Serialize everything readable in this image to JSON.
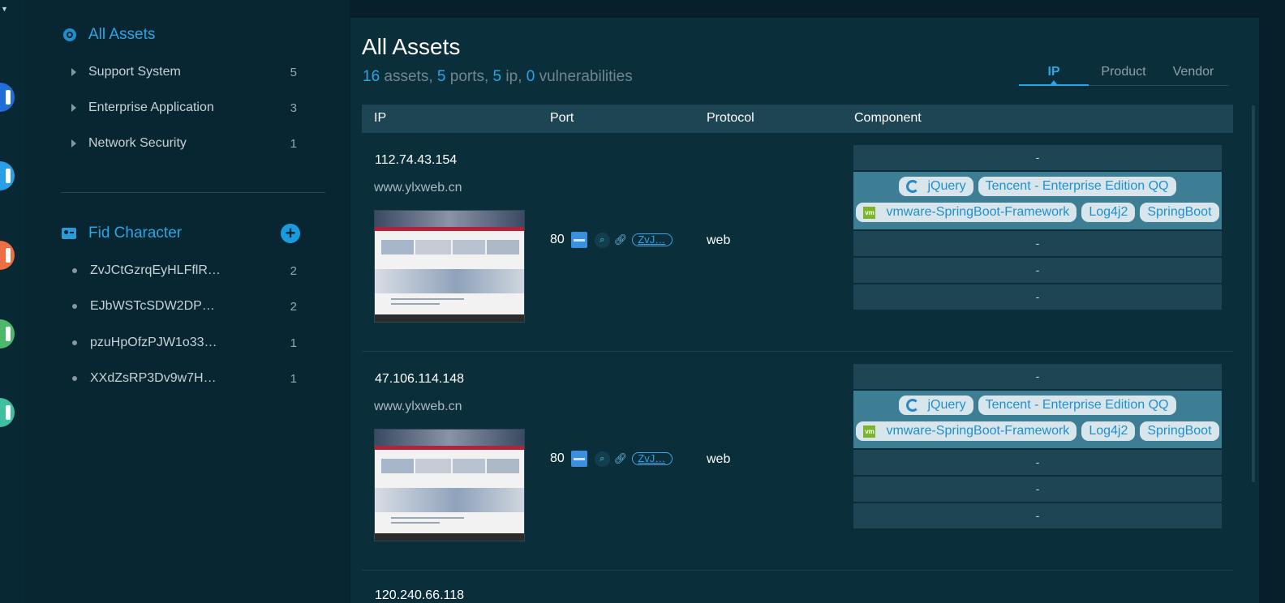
{
  "rail": {
    "icons": [
      {
        "name": "rail-app-icon-1",
        "color": "#1e6fd9"
      },
      {
        "name": "rail-app-icon-2",
        "color": "#2a9fe8"
      },
      {
        "name": "rail-app-icon-3",
        "color": "#ee6f43"
      },
      {
        "name": "rail-app-icon-4",
        "color": "#4cb86a"
      },
      {
        "name": "rail-app-icon-5",
        "color": "#3dbfa0"
      }
    ]
  },
  "sidebar": {
    "all_assets_label": "All Assets",
    "categories": [
      {
        "label": "Support System",
        "count": "5"
      },
      {
        "label": "Enterprise Application",
        "count": "3"
      },
      {
        "label": "Network Security",
        "count": "1"
      }
    ],
    "fid_section_label": "Fid Character",
    "fid_items": [
      {
        "label": "ZvJCtGzrqEyHLFflR…",
        "count": "2"
      },
      {
        "label": "EJbWSTcSDW2DP…",
        "count": "2"
      },
      {
        "label": "pzuHpOfzPJW1o33…",
        "count": "1"
      },
      {
        "label": "XXdZsRP3Dv9w7H…",
        "count": "1"
      }
    ]
  },
  "main": {
    "title": "All Assets",
    "summary": {
      "assets_num": "16",
      "assets_label": " assets, ",
      "ports_num": "5",
      "ports_label": " ports, ",
      "ip_num": "5",
      "ip_label": " ip, ",
      "vuln_num": "0",
      "vuln_label": " vulnerabilities"
    },
    "tabs": [
      "IP",
      "Product",
      "Vendor"
    ],
    "active_tab": "IP",
    "columns": {
      "ip": "IP",
      "port": "Port",
      "protocol": "Protocol",
      "component": "Component"
    },
    "rows": [
      {
        "ip": "112.74.43.154",
        "host": "www.ylxweb.cn",
        "port": "80",
        "fid_tag": "ZvJ…",
        "protocol": "web",
        "empty_cell": "-",
        "components": [
          "jQuery",
          "Tencent - Enterprise Edition QQ",
          "vmware-SpringBoot-Framework",
          "Log4j2",
          "SpringBoot"
        ],
        "vm_badge": "vm"
      },
      {
        "ip": "47.106.114.148",
        "host": "www.ylxweb.cn",
        "port": "80",
        "fid_tag": "ZvJ…",
        "protocol": "web",
        "empty_cell": "-",
        "components": [
          "jQuery",
          "Tencent - Enterprise Edition QQ",
          "vmware-SpringBoot-Framework",
          "Log4j2",
          "SpringBoot"
        ],
        "vm_badge": "vm"
      }
    ],
    "partial_row_ip": "120.240.66.118"
  }
}
